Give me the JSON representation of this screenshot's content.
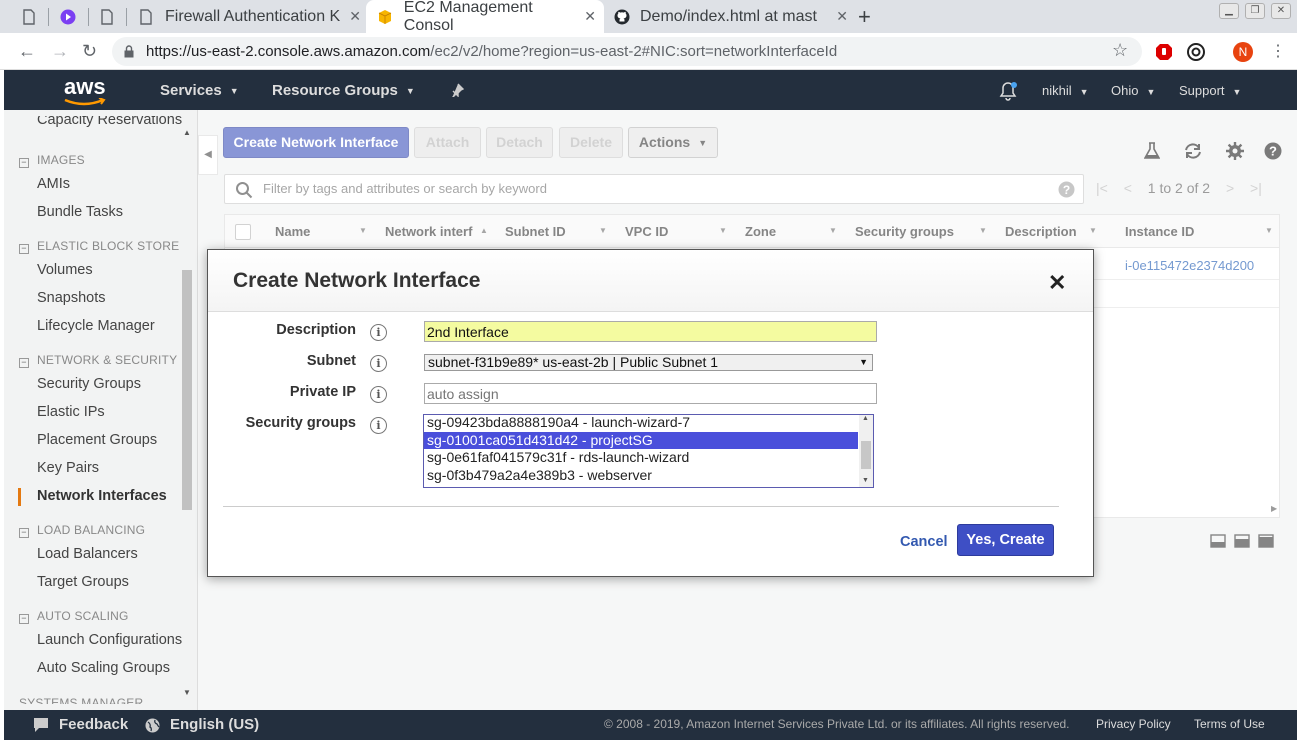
{
  "browser": {
    "tabs": [
      {
        "title": ""
      },
      {
        "title": ""
      },
      {
        "title": ""
      },
      {
        "title": "Firewall Authentication K"
      },
      {
        "title": "EC2 Management Consol"
      },
      {
        "title": "Demo/index.html at mast"
      }
    ],
    "new_tab": "+",
    "url_host": "https://us-east-2.console.aws.amazon.com",
    "url_path": "/ec2/v2/home?region=us-east-2#NIC:sort=networkInterfaceId",
    "profile_initial": "N"
  },
  "aws_nav": {
    "logo": "aws",
    "services": "Services",
    "resource_groups": "Resource Groups",
    "user": "nikhil",
    "region": "Ohio",
    "support": "Support"
  },
  "sidebar": {
    "top_cut": "Capacity Reservations",
    "sections": [
      {
        "title": "IMAGES",
        "items": [
          "AMIs",
          "Bundle Tasks"
        ]
      },
      {
        "title": "ELASTIC BLOCK STORE",
        "items": [
          "Volumes",
          "Snapshots",
          "Lifecycle Manager"
        ]
      },
      {
        "title": "NETWORK & SECURITY",
        "items": [
          "Security Groups",
          "Elastic IPs",
          "Placement Groups",
          "Key Pairs",
          "Network Interfaces"
        ]
      },
      {
        "title": "LOAD BALANCING",
        "items": [
          "Load Balancers",
          "Target Groups"
        ]
      },
      {
        "title": "AUTO SCALING",
        "items": [
          "Launch Configurations",
          "Auto Scaling Groups"
        ]
      }
    ],
    "bottom_cut": "SYSTEMS MANAGER"
  },
  "toolbar": {
    "create": "Create Network Interface",
    "attach": "Attach",
    "detach": "Detach",
    "delete": "Delete",
    "actions": "Actions"
  },
  "filter": {
    "placeholder": "Filter by tags and attributes or search by keyword",
    "pager": "1 to 2 of 2"
  },
  "table": {
    "columns": [
      "Name",
      "Network interf",
      "Subnet ID",
      "VPC ID",
      "Zone",
      "Security groups",
      "Description",
      "Instance ID"
    ],
    "rows": [
      {
        "instance_id": "i-0e115472e2374d200"
      }
    ]
  },
  "modal": {
    "title": "Create Network Interface",
    "fields": {
      "description_label": "Description",
      "description_value": "2nd Interface",
      "subnet_label": "Subnet",
      "subnet_value": "subnet-f31b9e89* us-east-2b | Public Subnet 1",
      "private_ip_label": "Private IP",
      "private_ip_placeholder": "auto assign",
      "sg_label": "Security groups"
    },
    "security_groups": [
      {
        "label": "sg-09423bda8888190a4 - launch-wizard-7",
        "selected": false
      },
      {
        "label": "sg-01001ca051d431d42 - projectSG",
        "selected": true
      },
      {
        "label": "sg-0e61faf041579c31f - rds-launch-wizard",
        "selected": false
      },
      {
        "label": "sg-0f3b479a2a4e389b3 - webserver",
        "selected": false
      }
    ],
    "cancel": "Cancel",
    "confirm": "Yes, Create"
  },
  "footer": {
    "feedback": "Feedback",
    "language": "English (US)",
    "copyright": "© 2008 - 2019, Amazon Internet Services Private Ltd. or its affiliates. All rights reserved.",
    "privacy": "Privacy Policy",
    "terms": "Terms of Use"
  }
}
